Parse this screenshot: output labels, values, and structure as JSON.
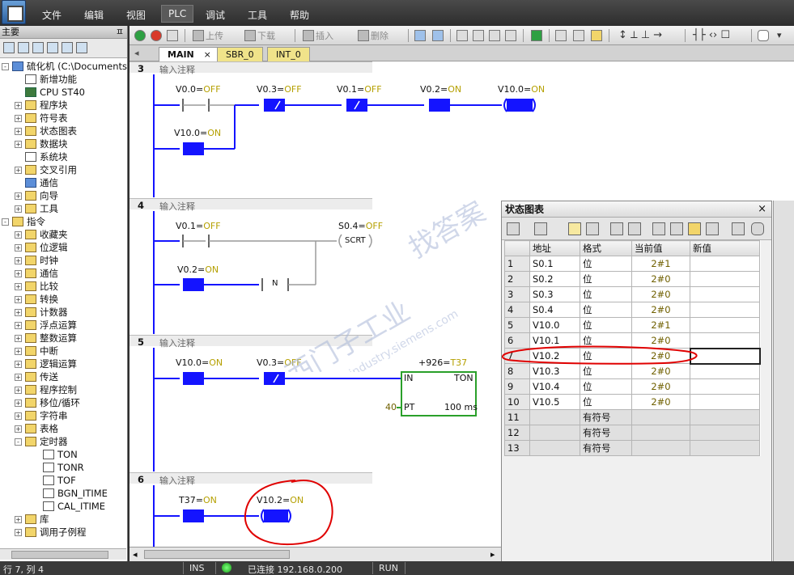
{
  "menu": {
    "items": [
      "文件",
      "编辑",
      "视图",
      "PLC",
      "调试",
      "工具",
      "帮助"
    ],
    "active": "PLC"
  },
  "toolbar": {
    "upload_label": "上传",
    "download_label": "下载",
    "insert_label": "插入",
    "delete_label": "删除"
  },
  "left_panel": {
    "title": "主要",
    "pin": "ㅍ",
    "project": "硫化机 (C:\\Documents a",
    "tree": [
      {
        "label": "新增功能",
        "level": 1,
        "exp": "",
        "icon": "doc"
      },
      {
        "label": "CPU ST40",
        "level": 1,
        "exp": "",
        "icon": "cpu"
      },
      {
        "label": "程序块",
        "level": 1,
        "exp": "+",
        "icon": "folder"
      },
      {
        "label": "符号表",
        "level": 1,
        "exp": "+",
        "icon": "folder"
      },
      {
        "label": "状态图表",
        "level": 1,
        "exp": "+",
        "icon": "folder"
      },
      {
        "label": "数据块",
        "level": 1,
        "exp": "+",
        "icon": "folder"
      },
      {
        "label": "系统块",
        "level": 1,
        "exp": "",
        "icon": "doc"
      },
      {
        "label": "交叉引用",
        "level": 1,
        "exp": "+",
        "icon": "folder"
      },
      {
        "label": "通信",
        "level": 1,
        "exp": "",
        "icon": "blue"
      },
      {
        "label": "向导",
        "level": 1,
        "exp": "+",
        "icon": "folder"
      },
      {
        "label": "工具",
        "level": 1,
        "exp": "+",
        "icon": "folder"
      },
      {
        "label": "指令",
        "level": 0,
        "exp": "-",
        "icon": "folder"
      },
      {
        "label": "收藏夹",
        "level": 1,
        "exp": "+",
        "icon": "folder"
      },
      {
        "label": "位逻辑",
        "level": 1,
        "exp": "+",
        "icon": "folder"
      },
      {
        "label": "时钟",
        "level": 1,
        "exp": "+",
        "icon": "folder"
      },
      {
        "label": "通信",
        "level": 1,
        "exp": "+",
        "icon": "folder"
      },
      {
        "label": "比较",
        "level": 1,
        "exp": "+",
        "icon": "folder"
      },
      {
        "label": "转换",
        "level": 1,
        "exp": "+",
        "icon": "folder"
      },
      {
        "label": "计数器",
        "level": 1,
        "exp": "+",
        "icon": "folder"
      },
      {
        "label": "浮点运算",
        "level": 1,
        "exp": "+",
        "icon": "folder"
      },
      {
        "label": "整数运算",
        "level": 1,
        "exp": "+",
        "icon": "folder"
      },
      {
        "label": "中断",
        "level": 1,
        "exp": "+",
        "icon": "folder"
      },
      {
        "label": "逻辑运算",
        "level": 1,
        "exp": "+",
        "icon": "folder"
      },
      {
        "label": "传送",
        "level": 1,
        "exp": "+",
        "icon": "folder"
      },
      {
        "label": "程序控制",
        "level": 1,
        "exp": "+",
        "icon": "folder"
      },
      {
        "label": "移位/循环",
        "level": 1,
        "exp": "+",
        "icon": "folder"
      },
      {
        "label": "字符串",
        "level": 1,
        "exp": "+",
        "icon": "folder"
      },
      {
        "label": "表格",
        "level": 1,
        "exp": "+",
        "icon": "folder"
      },
      {
        "label": "定时器",
        "level": 1,
        "exp": "-",
        "icon": "folder"
      },
      {
        "label": "TON",
        "level": 2,
        "exp": "",
        "icon": "doc"
      },
      {
        "label": "TONR",
        "level": 2,
        "exp": "",
        "icon": "doc"
      },
      {
        "label": "TOF",
        "level": 2,
        "exp": "",
        "icon": "doc"
      },
      {
        "label": "BGN_ITIME",
        "level": 2,
        "exp": "",
        "icon": "doc"
      },
      {
        "label": "CAL_ITIME",
        "level": 2,
        "exp": "",
        "icon": "doc"
      },
      {
        "label": "库",
        "level": 1,
        "exp": "+",
        "icon": "folder"
      },
      {
        "label": "调用子例程",
        "level": 1,
        "exp": "+",
        "icon": "folder"
      }
    ]
  },
  "tabs": [
    "MAIN",
    "SBR_0",
    "INT_0"
  ],
  "tab_close": "×",
  "networks": [
    {
      "num": "3",
      "comment": "输入注释"
    },
    {
      "num": "4",
      "comment": "输入注释"
    },
    {
      "num": "5",
      "comment": "输入注释"
    },
    {
      "num": "6",
      "comment": "输入注释"
    }
  ],
  "ladder_labels": {
    "n3_c1": "V0.0=OFF",
    "n3_c2": "V0.3=OFF",
    "n3_c3": "V0.1=OFF",
    "n3_c4": "V0.2=ON",
    "n3_coil": "V10.0=ON",
    "n3_branch": "V10.0=ON",
    "n4_c1": "V0.1=OFF",
    "n4_c2": "V0.2=ON",
    "n4_n": "N",
    "n4_coil": "S0.4=OFF",
    "n4_scrt": "SCRT",
    "n5_c1": "V10.0=ON",
    "n5_c2": "V0.3=OFF",
    "n5_timer": "+926=T37",
    "n5_in": "IN",
    "n5_ton": "TON",
    "n5_pt": "PT",
    "n5_pt_val": "40",
    "n5_base": "100 ms",
    "n6_c1": "T37=ON",
    "n6_coil": "V10.2=ON"
  },
  "status_window": {
    "title": "状态图表",
    "close": "×",
    "headers": [
      "",
      "地址",
      "格式",
      "当前值",
      "新值"
    ],
    "rows": [
      {
        "n": "1",
        "addr": "S0.1",
        "fmt": "位",
        "cur": "2#1",
        "new": ""
      },
      {
        "n": "2",
        "addr": "S0.2",
        "fmt": "位",
        "cur": "2#0",
        "new": ""
      },
      {
        "n": "3",
        "addr": "S0.3",
        "fmt": "位",
        "cur": "2#0",
        "new": ""
      },
      {
        "n": "4",
        "addr": "S0.4",
        "fmt": "位",
        "cur": "2#0",
        "new": ""
      },
      {
        "n": "5",
        "addr": "V10.0",
        "fmt": "位",
        "cur": "2#1",
        "new": ""
      },
      {
        "n": "6",
        "addr": "V10.1",
        "fmt": "位",
        "cur": "2#0",
        "new": ""
      },
      {
        "n": "7",
        "addr": "V10.2",
        "fmt": "位",
        "cur": "2#0",
        "new": ""
      },
      {
        "n": "8",
        "addr": "V10.3",
        "fmt": "位",
        "cur": "2#0",
        "new": ""
      },
      {
        "n": "9",
        "addr": "V10.4",
        "fmt": "位",
        "cur": "2#0",
        "new": ""
      },
      {
        "n": "10",
        "addr": "V10.5",
        "fmt": "位",
        "cur": "2#0",
        "new": ""
      },
      {
        "n": "11",
        "addr": "",
        "fmt": "有符号",
        "cur": "",
        "new": ""
      },
      {
        "n": "12",
        "addr": "",
        "fmt": "有符号",
        "cur": "",
        "new": ""
      },
      {
        "n": "13",
        "addr": "",
        "fmt": "有符号",
        "cur": "",
        "new": ""
      }
    ]
  },
  "statusbar": {
    "position": "行 7, 列 4",
    "mode": "INS",
    "connection": "已连接 192.168.0.200",
    "run": "RUN"
  },
  "watermark": {
    "line1": "西门子工业",
    "line2": "support.industry.siemens.com",
    "line3": "找答案"
  },
  "colors": {
    "contact_active": "#1414ff",
    "wire_active": "#1414ff",
    "wire_inactive": "#9a9a9a",
    "label_off": "#b5a000",
    "label_name": "#000000",
    "timer_box": "#2aa02a",
    "annotation_red": "#e00000"
  }
}
